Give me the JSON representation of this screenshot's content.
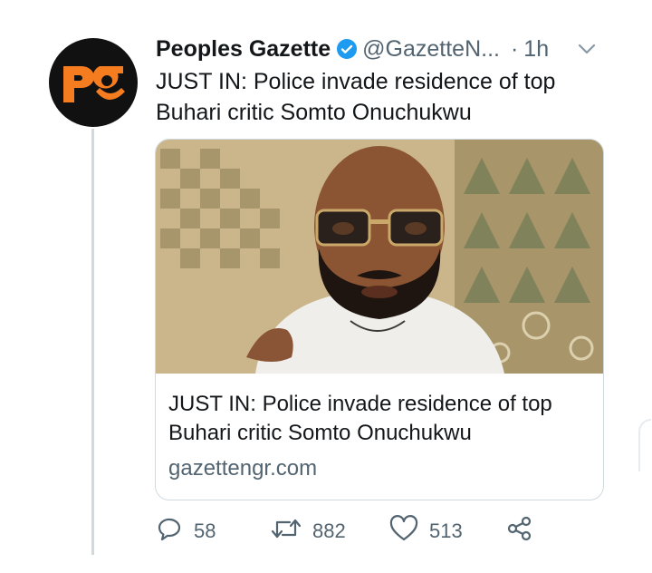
{
  "author": {
    "name": "Peoples Gazette",
    "handle": "@GazetteN...",
    "separator": "·",
    "time": "1h",
    "avatar_logo_text": "pg",
    "verified": true
  },
  "tweet": {
    "text": "JUST IN: Police invade residence of top Buhari critic Somto Onuchukwu"
  },
  "card": {
    "title": "JUST IN: Police invade residence of top Buhari critic Somto Onuchukwu",
    "domain": "gazettengr.com",
    "image_alt": "Photo of a bearded man wearing glasses"
  },
  "actions": {
    "reply_count": "58",
    "retweet_count": "882",
    "like_count": "513"
  },
  "icons": {
    "verified": "verified-badge-icon",
    "caret": "chevron-down-icon",
    "reply": "reply-icon",
    "retweet": "retweet-icon",
    "like": "heart-icon",
    "share": "share-icon"
  },
  "colors": {
    "brand_orange": "#f57c1f",
    "verified_blue": "#1d9bf0",
    "muted_text": "#536471",
    "primary_text": "#14171a"
  }
}
